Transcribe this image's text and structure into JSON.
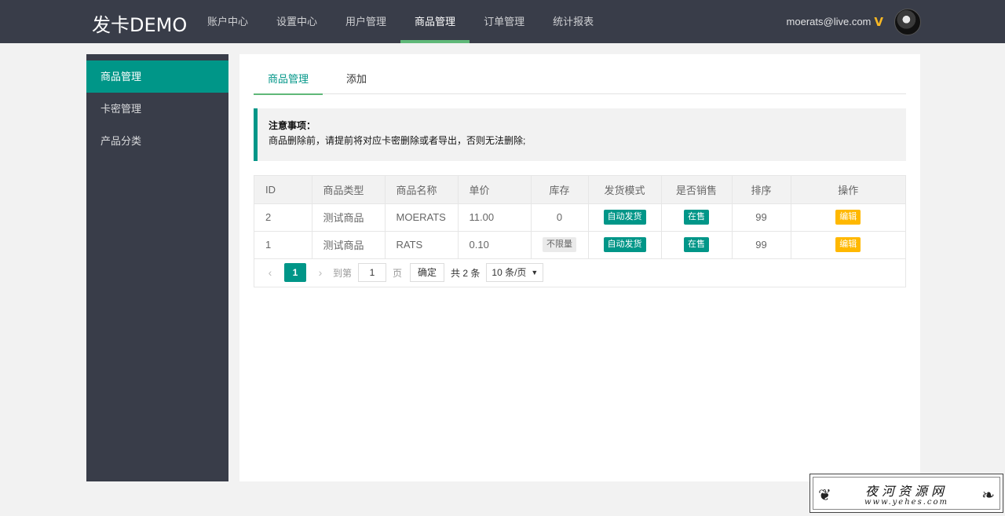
{
  "header": {
    "logo": "发卡DEMO",
    "nav": [
      {
        "label": "账户中心"
      },
      {
        "label": "设置中心"
      },
      {
        "label": "用户管理"
      },
      {
        "label": "商品管理",
        "active": true
      },
      {
        "label": "订单管理"
      },
      {
        "label": "统计报表"
      }
    ],
    "user_email": "moerats@live.com",
    "vip_badge": "V"
  },
  "sidebar": {
    "items": [
      {
        "label": "商品管理",
        "active": true
      },
      {
        "label": "卡密管理"
      },
      {
        "label": "产品分类"
      }
    ]
  },
  "tabs": [
    {
      "label": "商品管理",
      "active": true
    },
    {
      "label": "添加"
    }
  ],
  "notice": {
    "title": "注意事项：",
    "text": "商品删除前，请提前将对应卡密删除或者导出，否则无法删除;"
  },
  "table": {
    "columns": [
      "ID",
      "商品类型",
      "商品名称",
      "单价",
      "库存",
      "发货模式",
      "是否销售",
      "排序",
      "操作"
    ],
    "rows": [
      {
        "id": "2",
        "type": "测试商品",
        "name": "MOERATS",
        "price": "11.00",
        "stock": "0",
        "delivery": "自动发货",
        "on_sale": "在售",
        "sort": "99",
        "action": "编辑"
      },
      {
        "id": "1",
        "type": "测试商品",
        "name": "RATS",
        "price": "0.10",
        "stock": "不限量",
        "delivery": "自动发货",
        "on_sale": "在售",
        "sort": "99",
        "action": "编辑"
      }
    ]
  },
  "pager": {
    "prev": "‹",
    "current": "1",
    "next": "›",
    "goto_label": "到第",
    "goto_value": "1",
    "page_label": "页",
    "confirm": "确定",
    "total": "共 2 条",
    "page_size": "10 条/页"
  },
  "watermark": {
    "title": "夜河资源网",
    "url": "www.yehes.com"
  },
  "colors": {
    "header_bg": "#393d49",
    "accent": "#009688",
    "tab_underline": "#5fb878",
    "edit_tag": "#ffb800"
  }
}
